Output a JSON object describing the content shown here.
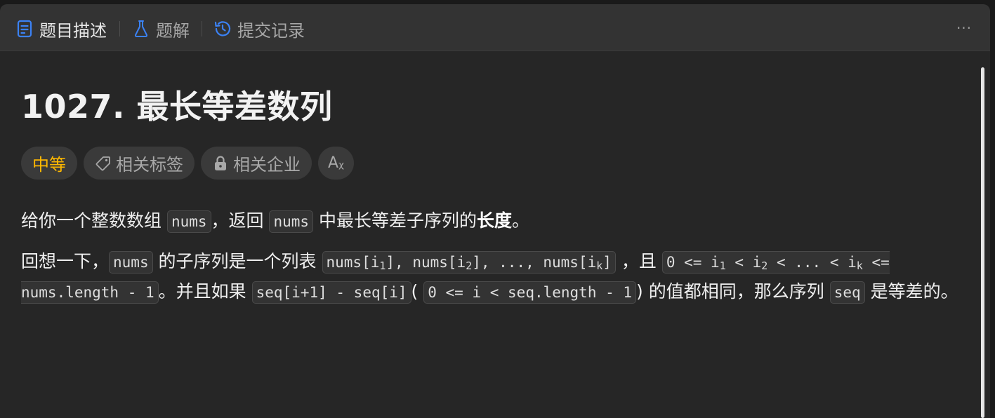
{
  "tabs": [
    {
      "label": "题目描述",
      "icon": "document-icon",
      "active": true
    },
    {
      "label": "题解",
      "icon": "flask-icon",
      "active": false
    },
    {
      "label": "提交记录",
      "icon": "history-icon",
      "active": false
    }
  ],
  "more_label": "···",
  "problem": {
    "title": "1027. 最长等差数列",
    "difficulty": "中等",
    "difficulty_color": "#ffb800",
    "tags": [
      {
        "label": "相关标签",
        "icon": "tag-icon"
      },
      {
        "label": "相关企业",
        "icon": "lock-icon"
      }
    ],
    "lang_toggle": "Aᵪ"
  },
  "description": {
    "p1": {
      "t1": "给你一个整数数组 ",
      "c1": "nums",
      "t2": "，返回 ",
      "c2": "nums",
      "t3": " 中最长等差子序列的",
      "bold": "长度",
      "t4": "。"
    },
    "p2": {
      "t1": "回想一下，",
      "c1": "nums",
      "t2": " 的子序列是一个列表 ",
      "c2a": "nums[i",
      "s1": "1",
      "c2b": "], nums[i",
      "s2": "2",
      "c2c": "], ..., nums[i",
      "sk": "k",
      "c2d": "]",
      "t3": " ，且 ",
      "c3a": "0 <= i",
      "c3s1": "1",
      "c3b": " < i",
      "c3s2": "2",
      "c3c": " < ... < i",
      "c3sk": "k",
      "c3d": " <= nums.length - 1",
      "t4": "。并且如果 ",
      "c4": "seq[i+1] - seq[i]",
      "t5": "( ",
      "c5": "0 <= i < seq.length - 1",
      "t6": ") 的值都相同，那么序列 ",
      "c6": "seq",
      "t7": " 是等差的。"
    }
  }
}
